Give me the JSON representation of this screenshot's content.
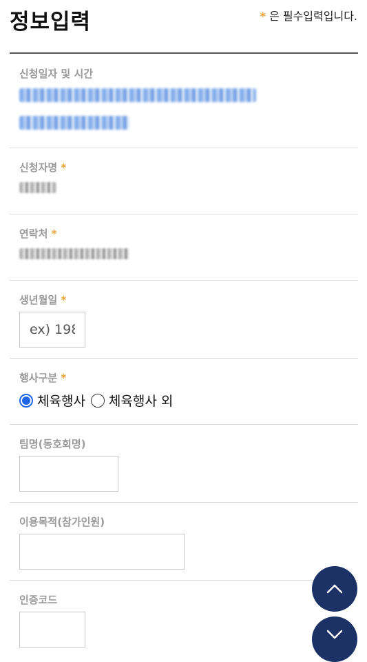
{
  "header": {
    "title": "정보입력",
    "required_star": "*",
    "required_note": "은 필수입력입니다."
  },
  "fields": {
    "apply_datetime": {
      "label": "신청일자 및 시간"
    },
    "applicant": {
      "label": "신청자명",
      "star": "*"
    },
    "contact": {
      "label": "연락처",
      "star": "*"
    },
    "birth": {
      "label": "생년월일",
      "star": "*",
      "placeholder": "ex) 198",
      "value": ""
    },
    "event_type": {
      "label": "행사구분",
      "star": "*",
      "options": [
        "체육행사",
        "체육행사 외"
      ],
      "selected": 0
    },
    "team": {
      "label": "팀명(동호회명)",
      "value": ""
    },
    "purpose": {
      "label": "이용목적(참가인원)",
      "value": ""
    },
    "auth_code": {
      "label": "인증코드",
      "value": ""
    }
  },
  "colors": {
    "accent_star": "#f0a030",
    "radio_selected": "#1e66e6",
    "fab_bg": "#1c3266"
  },
  "icons": {
    "scroll_up": "chevron-up-icon",
    "scroll_down": "chevron-down-icon"
  }
}
